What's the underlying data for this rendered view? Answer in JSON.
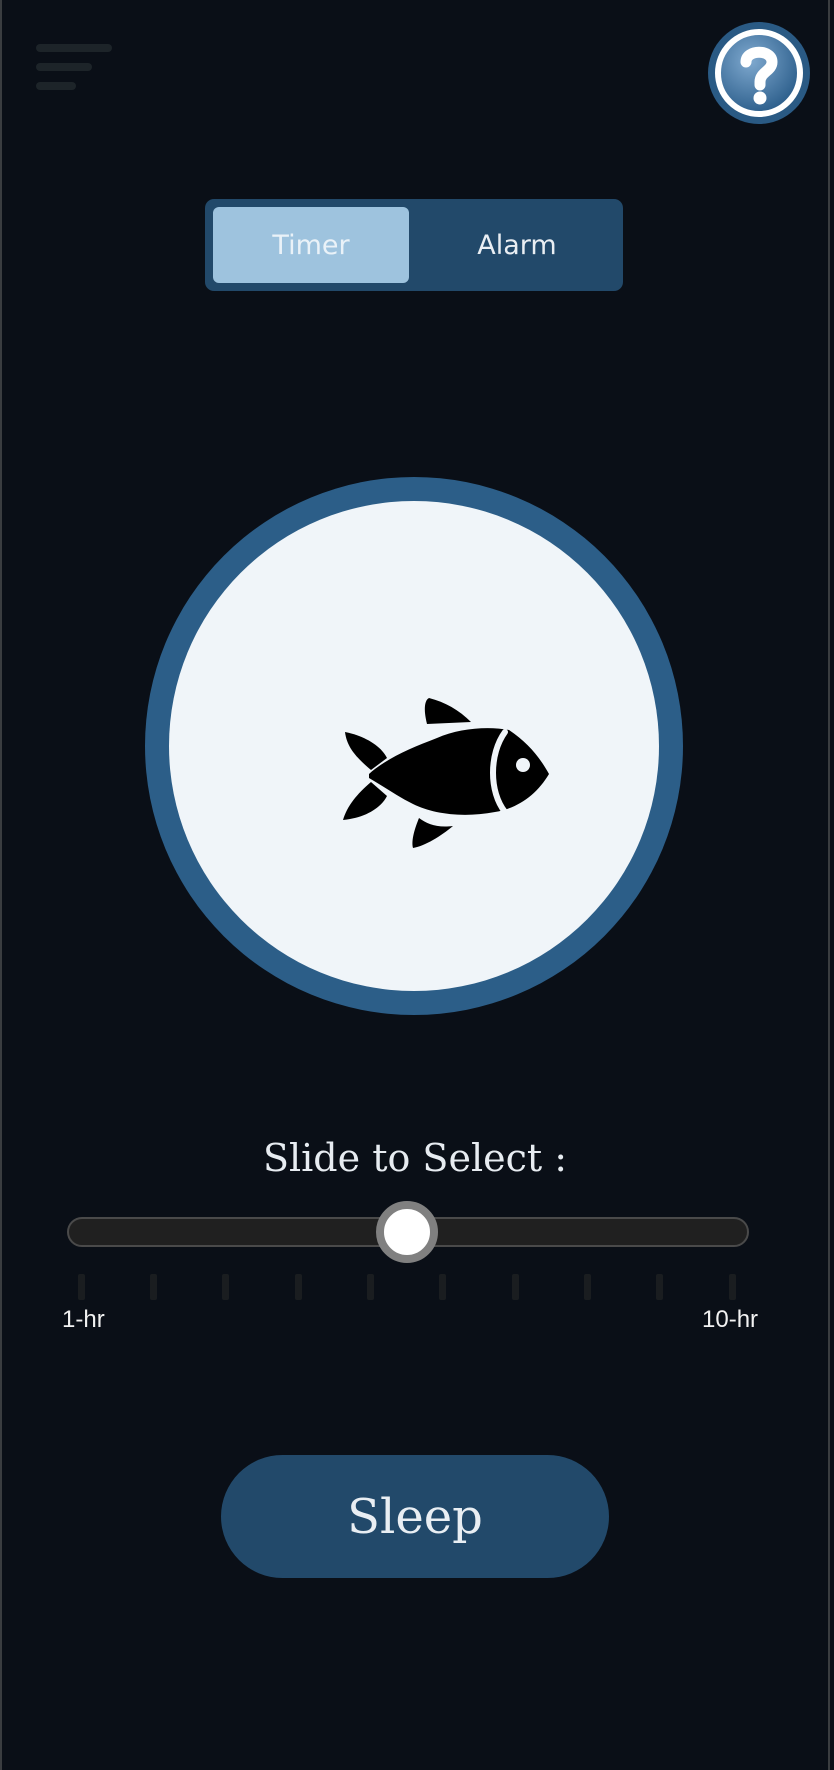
{
  "header": {
    "menu_icon": "hamburger-menu-icon",
    "help_icon": "question-mark-icon"
  },
  "mode_toggle": {
    "options": [
      "Timer",
      "Alarm"
    ],
    "selected": "Timer"
  },
  "display": {
    "icon": "fish-icon"
  },
  "slider": {
    "label": "Slide to Select :",
    "min_label": "1-hr",
    "max_label": "10-hr",
    "min": 1,
    "max": 10,
    "value": 5.5,
    "tick_count": 10
  },
  "action": {
    "label": "Sleep"
  },
  "colors": {
    "background": "#0a0f17",
    "accent": "#22496a",
    "ring": "#2c5e88",
    "selected_tab": "#9ec3de"
  }
}
